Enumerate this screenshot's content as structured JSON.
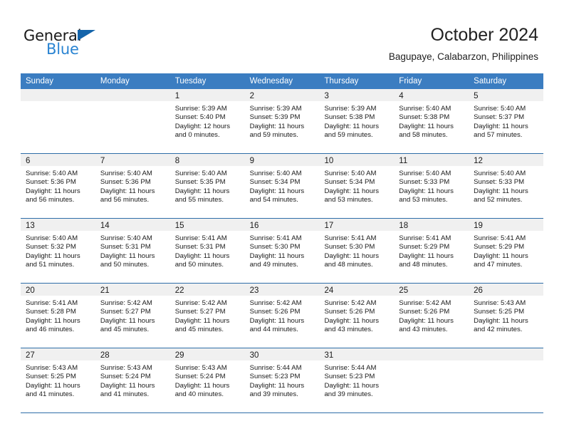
{
  "branding": {
    "logo_primary": "General",
    "logo_secondary": "Blue",
    "logo_icon": "triangle-icon",
    "primary_color": "#1a1a1a",
    "secondary_color": "#2a84d2"
  },
  "header": {
    "title": "October 2024",
    "subtitle": "Bagupaye, Calabarzon, Philippines"
  },
  "calendar": {
    "header_color": "#3b7dc1",
    "weekdays": [
      "Sunday",
      "Monday",
      "Tuesday",
      "Wednesday",
      "Thursday",
      "Friday",
      "Saturday"
    ],
    "weeks": [
      [
        {
          "day": "",
          "lines": []
        },
        {
          "day": "",
          "lines": []
        },
        {
          "day": "1",
          "lines": [
            "Sunrise: 5:39 AM",
            "Sunset: 5:40 PM",
            "Daylight: 12 hours",
            "and 0 minutes."
          ]
        },
        {
          "day": "2",
          "lines": [
            "Sunrise: 5:39 AM",
            "Sunset: 5:39 PM",
            "Daylight: 11 hours",
            "and 59 minutes."
          ]
        },
        {
          "day": "3",
          "lines": [
            "Sunrise: 5:39 AM",
            "Sunset: 5:38 PM",
            "Daylight: 11 hours",
            "and 59 minutes."
          ]
        },
        {
          "day": "4",
          "lines": [
            "Sunrise: 5:40 AM",
            "Sunset: 5:38 PM",
            "Daylight: 11 hours",
            "and 58 minutes."
          ]
        },
        {
          "day": "5",
          "lines": [
            "Sunrise: 5:40 AM",
            "Sunset: 5:37 PM",
            "Daylight: 11 hours",
            "and 57 minutes."
          ]
        }
      ],
      [
        {
          "day": "6",
          "lines": [
            "Sunrise: 5:40 AM",
            "Sunset: 5:36 PM",
            "Daylight: 11 hours",
            "and 56 minutes."
          ]
        },
        {
          "day": "7",
          "lines": [
            "Sunrise: 5:40 AM",
            "Sunset: 5:36 PM",
            "Daylight: 11 hours",
            "and 56 minutes."
          ]
        },
        {
          "day": "8",
          "lines": [
            "Sunrise: 5:40 AM",
            "Sunset: 5:35 PM",
            "Daylight: 11 hours",
            "and 55 minutes."
          ]
        },
        {
          "day": "9",
          "lines": [
            "Sunrise: 5:40 AM",
            "Sunset: 5:34 PM",
            "Daylight: 11 hours",
            "and 54 minutes."
          ]
        },
        {
          "day": "10",
          "lines": [
            "Sunrise: 5:40 AM",
            "Sunset: 5:34 PM",
            "Daylight: 11 hours",
            "and 53 minutes."
          ]
        },
        {
          "day": "11",
          "lines": [
            "Sunrise: 5:40 AM",
            "Sunset: 5:33 PM",
            "Daylight: 11 hours",
            "and 53 minutes."
          ]
        },
        {
          "day": "12",
          "lines": [
            "Sunrise: 5:40 AM",
            "Sunset: 5:33 PM",
            "Daylight: 11 hours",
            "and 52 minutes."
          ]
        }
      ],
      [
        {
          "day": "13",
          "lines": [
            "Sunrise: 5:40 AM",
            "Sunset: 5:32 PM",
            "Daylight: 11 hours",
            "and 51 minutes."
          ]
        },
        {
          "day": "14",
          "lines": [
            "Sunrise: 5:40 AM",
            "Sunset: 5:31 PM",
            "Daylight: 11 hours",
            "and 50 minutes."
          ]
        },
        {
          "day": "15",
          "lines": [
            "Sunrise: 5:41 AM",
            "Sunset: 5:31 PM",
            "Daylight: 11 hours",
            "and 50 minutes."
          ]
        },
        {
          "day": "16",
          "lines": [
            "Sunrise: 5:41 AM",
            "Sunset: 5:30 PM",
            "Daylight: 11 hours",
            "and 49 minutes."
          ]
        },
        {
          "day": "17",
          "lines": [
            "Sunrise: 5:41 AM",
            "Sunset: 5:30 PM",
            "Daylight: 11 hours",
            "and 48 minutes."
          ]
        },
        {
          "day": "18",
          "lines": [
            "Sunrise: 5:41 AM",
            "Sunset: 5:29 PM",
            "Daylight: 11 hours",
            "and 48 minutes."
          ]
        },
        {
          "day": "19",
          "lines": [
            "Sunrise: 5:41 AM",
            "Sunset: 5:29 PM",
            "Daylight: 11 hours",
            "and 47 minutes."
          ]
        }
      ],
      [
        {
          "day": "20",
          "lines": [
            "Sunrise: 5:41 AM",
            "Sunset: 5:28 PM",
            "Daylight: 11 hours",
            "and 46 minutes."
          ]
        },
        {
          "day": "21",
          "lines": [
            "Sunrise: 5:42 AM",
            "Sunset: 5:27 PM",
            "Daylight: 11 hours",
            "and 45 minutes."
          ]
        },
        {
          "day": "22",
          "lines": [
            "Sunrise: 5:42 AM",
            "Sunset: 5:27 PM",
            "Daylight: 11 hours",
            "and 45 minutes."
          ]
        },
        {
          "day": "23",
          "lines": [
            "Sunrise: 5:42 AM",
            "Sunset: 5:26 PM",
            "Daylight: 11 hours",
            "and 44 minutes."
          ]
        },
        {
          "day": "24",
          "lines": [
            "Sunrise: 5:42 AM",
            "Sunset: 5:26 PM",
            "Daylight: 11 hours",
            "and 43 minutes."
          ]
        },
        {
          "day": "25",
          "lines": [
            "Sunrise: 5:42 AM",
            "Sunset: 5:26 PM",
            "Daylight: 11 hours",
            "and 43 minutes."
          ]
        },
        {
          "day": "26",
          "lines": [
            "Sunrise: 5:43 AM",
            "Sunset: 5:25 PM",
            "Daylight: 11 hours",
            "and 42 minutes."
          ]
        }
      ],
      [
        {
          "day": "27",
          "lines": [
            "Sunrise: 5:43 AM",
            "Sunset: 5:25 PM",
            "Daylight: 11 hours",
            "and 41 minutes."
          ]
        },
        {
          "day": "28",
          "lines": [
            "Sunrise: 5:43 AM",
            "Sunset: 5:24 PM",
            "Daylight: 11 hours",
            "and 41 minutes."
          ]
        },
        {
          "day": "29",
          "lines": [
            "Sunrise: 5:43 AM",
            "Sunset: 5:24 PM",
            "Daylight: 11 hours",
            "and 40 minutes."
          ]
        },
        {
          "day": "30",
          "lines": [
            "Sunrise: 5:44 AM",
            "Sunset: 5:23 PM",
            "Daylight: 11 hours",
            "and 39 minutes."
          ]
        },
        {
          "day": "31",
          "lines": [
            "Sunrise: 5:44 AM",
            "Sunset: 5:23 PM",
            "Daylight: 11 hours",
            "and 39 minutes."
          ]
        },
        {
          "day": "",
          "lines": []
        },
        {
          "day": "",
          "lines": []
        }
      ]
    ]
  }
}
